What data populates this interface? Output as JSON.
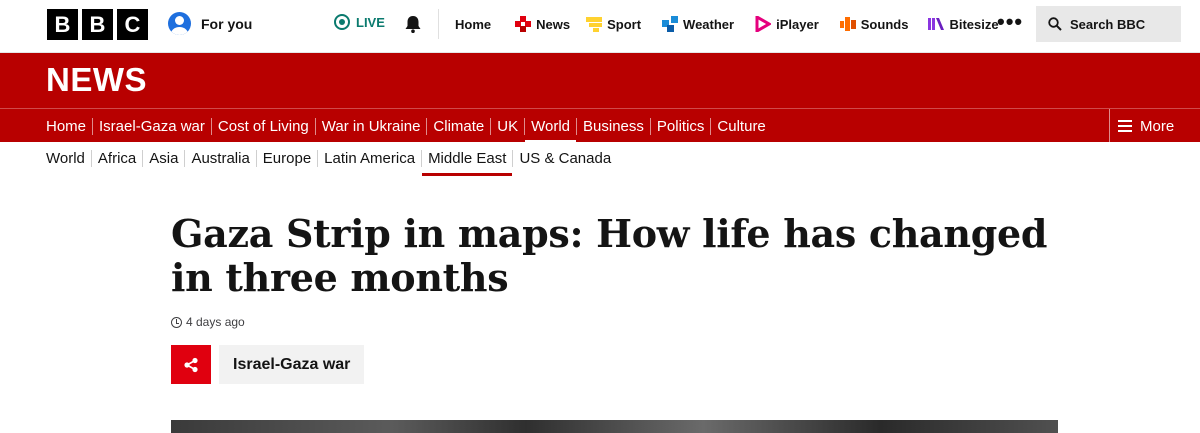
{
  "brand": {
    "letters": [
      "B",
      "B",
      "C"
    ]
  },
  "account": {
    "label": "For you"
  },
  "live": {
    "label": "LIVE",
    "color": "#0a7a6e"
  },
  "top_nav": [
    {
      "label": "Home",
      "icon": ""
    },
    {
      "label": "News",
      "icon": "news-icon"
    },
    {
      "label": "Sport",
      "icon": "sport-icon"
    },
    {
      "label": "Weather",
      "icon": "weather-icon"
    },
    {
      "label": "iPlayer",
      "icon": "iplayer-icon"
    },
    {
      "label": "Sounds",
      "icon": "sounds-icon"
    },
    {
      "label": "Bitesize",
      "icon": "bitesize-icon"
    }
  ],
  "search": {
    "label": "Search BBC"
  },
  "news": {
    "title": "NEWS",
    "accent": "#b80000"
  },
  "section_nav": {
    "items": [
      "Home",
      "Israel-Gaza war",
      "Cost of Living",
      "War in Ukraine",
      "Climate",
      "UK",
      "World",
      "Business",
      "Politics",
      "Culture"
    ],
    "active": "World",
    "more_label": "More"
  },
  "sub_nav": {
    "items": [
      "World",
      "Africa",
      "Asia",
      "Australia",
      "Europe",
      "Latin America",
      "Middle East",
      "US & Canada"
    ],
    "active": "Middle East"
  },
  "article": {
    "headline": "Gaza Strip in maps: How life has changed in three months",
    "timestamp": "4 days ago",
    "tag": "Israel-Gaza war"
  }
}
